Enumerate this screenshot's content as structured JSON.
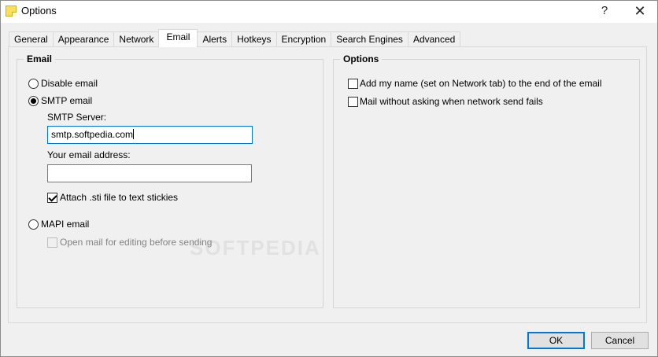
{
  "window": {
    "title": "Options",
    "help_label": "?",
    "close_label": "✕"
  },
  "tabs": [
    {
      "label": "General"
    },
    {
      "label": "Appearance"
    },
    {
      "label": "Network"
    },
    {
      "label": "Email",
      "active": true
    },
    {
      "label": "Alerts"
    },
    {
      "label": "Hotkeys"
    },
    {
      "label": "Encryption"
    },
    {
      "label": "Search Engines"
    },
    {
      "label": "Advanced"
    }
  ],
  "email_group": {
    "title": "Email",
    "disable_email_label": "Disable email",
    "smtp_email_label": "SMTP email",
    "smtp_server_label": "SMTP Server:",
    "smtp_server_value": "smtp.softpedia.com",
    "email_address_label": "Your email address:",
    "email_address_value": "",
    "attach_sti_label": "Attach .sti file to text stickies",
    "mapi_email_label": "MAPI email",
    "open_mail_label": "Open mail for editing before sending",
    "selected_mode": "SMTP email",
    "attach_sti_checked": true,
    "open_mail_checked": false
  },
  "options_group": {
    "title": "Options",
    "add_name_label": "Add my name (set on Network tab) to the end of the email",
    "mail_without_asking_label": "Mail without asking when network send fails",
    "add_name_checked": false,
    "mail_without_asking_checked": false
  },
  "buttons": {
    "ok_label": "OK",
    "cancel_label": "Cancel"
  },
  "watermark": "SOFTPEDIA",
  "colors": {
    "focus_border": "#0078d7",
    "dialog_bg": "#f0f0f0"
  }
}
